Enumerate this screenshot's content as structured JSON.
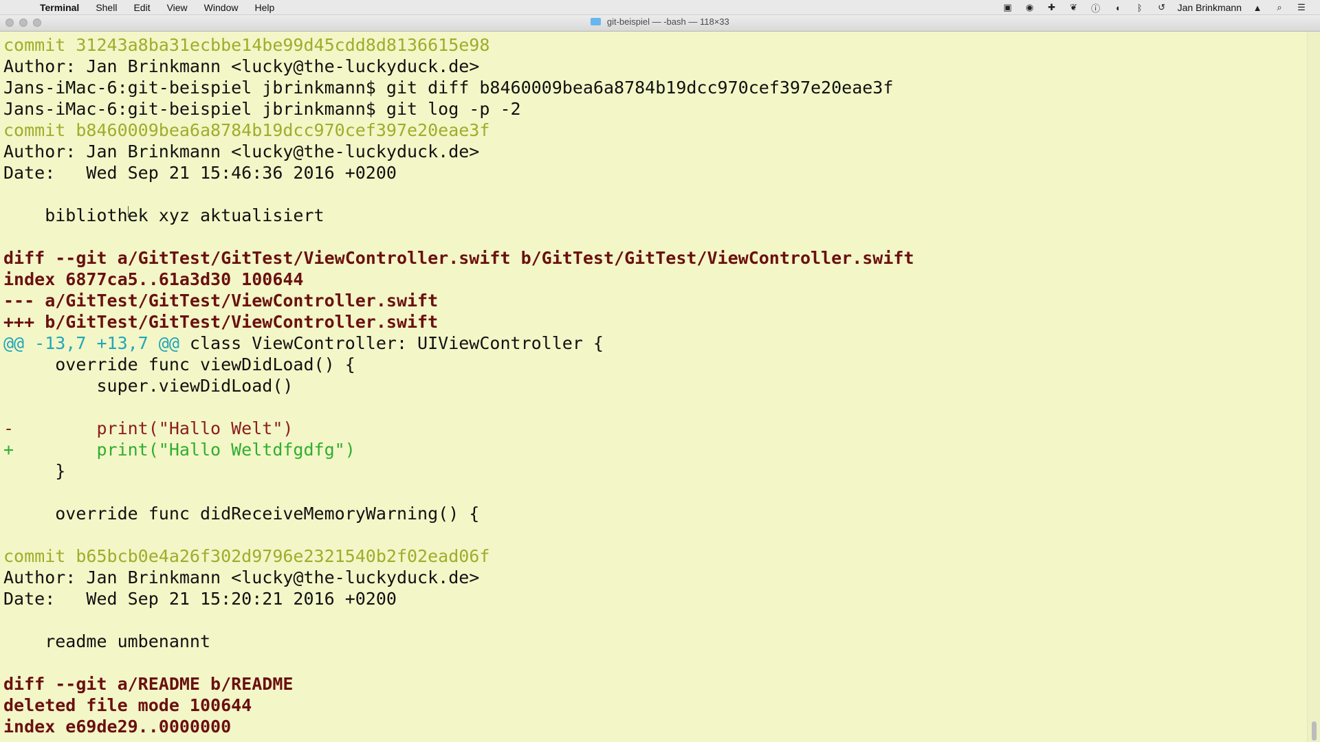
{
  "menubar": {
    "apple_icon": "apple-icon",
    "items": [
      "Terminal",
      "Shell",
      "Edit",
      "View",
      "Window",
      "Help"
    ],
    "status": {
      "user": "Jan Brinkmann"
    }
  },
  "window": {
    "title": "git-beispiel — -bash — 118×33",
    "folder_icon": "folder-icon"
  },
  "terminal": {
    "lines": [
      {
        "text": "commit 31243a8ba31ecbbe14be99d45cdd8d8136615e98",
        "type": "commit"
      },
      {
        "text": "Author: Jan Brinkmann <lucky@the-luckyduck.de>",
        "type": "meta"
      },
      {
        "text": "Jans-iMac-6:git-beispiel jbrinkmann$ git diff b8460009bea6a8784b19dcc970cef397e20eae3f",
        "type": "meta"
      },
      {
        "text": "Jans-iMac-6:git-beispiel jbrinkmann$ git log -p -2",
        "type": "meta"
      },
      {
        "text": "commit b8460009bea6a8784b19dcc970cef397e20eae3f",
        "type": "commit"
      },
      {
        "text": "Author: Jan Brinkmann <lucky@the-luckyduck.de>",
        "type": "meta"
      },
      {
        "text": "Date:   Wed Sep 21 15:46:36 2016 +0200",
        "type": "meta"
      },
      {
        "text": "",
        "type": "meta"
      },
      {
        "text": "    bibliothek xyz aktualisiert",
        "type": "meta"
      },
      {
        "text": "",
        "type": "meta"
      },
      {
        "text": "diff --git a/GitTest/GitTest/ViewController.swift b/GitTest/GitTest/ViewController.swift",
        "type": "diff"
      },
      {
        "text": "index 6877ca5..61a3d30 100644",
        "type": "diff"
      },
      {
        "text": "--- a/GitTest/GitTest/ViewController.swift",
        "type": "diff"
      },
      {
        "text": "+++ b/GitTest/GitTest/ViewController.swift",
        "type": "diff"
      },
      {
        "segments": [
          {
            "text": "@@ -13,7 +13,7 @@",
            "type": "hunk"
          },
          {
            "text": " class ViewController: UIViewController {",
            "type": "meta"
          }
        ]
      },
      {
        "text": "     override func viewDidLoad() {",
        "type": "meta"
      },
      {
        "text": "         super.viewDidLoad()",
        "type": "meta"
      },
      {
        "text": "",
        "type": "meta"
      },
      {
        "text": "-        print(\"Hallo Welt\")",
        "type": "del"
      },
      {
        "text": "+        print(\"Hallo Weltdfgdfg\")",
        "type": "add"
      },
      {
        "text": "     }",
        "type": "meta"
      },
      {
        "text": "",
        "type": "meta"
      },
      {
        "text": "     override func didReceiveMemoryWarning() {",
        "type": "meta"
      },
      {
        "text": "",
        "type": "meta"
      },
      {
        "text": "commit b65bcb0e4a26f302d9796e2321540b2f02ead06f",
        "type": "commit"
      },
      {
        "text": "Author: Jan Brinkmann <lucky@the-luckyduck.de>",
        "type": "meta"
      },
      {
        "text": "Date:   Wed Sep 21 15:20:21 2016 +0200",
        "type": "meta"
      },
      {
        "text": "",
        "type": "meta"
      },
      {
        "text": "    readme umbenannt",
        "type": "meta"
      },
      {
        "text": "",
        "type": "meta"
      },
      {
        "text": "diff --git a/README b/README",
        "type": "diff"
      },
      {
        "text": "deleted file mode 100644",
        "type": "diff"
      },
      {
        "text": "index e69de29..0000000",
        "type": "diff"
      }
    ]
  },
  "colors": {
    "background": "#f3f6c7",
    "commit": "#9ead2a",
    "diff": "#6a1010",
    "hunk": "#21a6b9",
    "deleted": "#8b1e1e",
    "added": "#2fae30"
  }
}
